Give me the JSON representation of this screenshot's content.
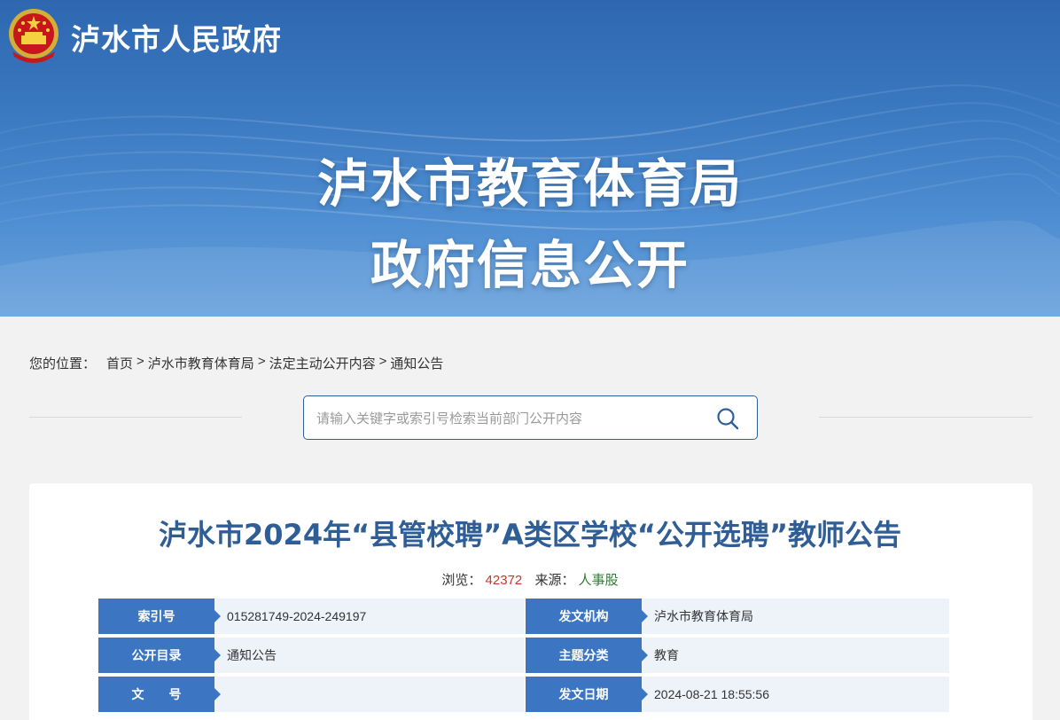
{
  "header": {
    "site_name": "泸水市人民政府",
    "banner_line1": "泸水市教育体育局",
    "banner_line2": "政府信息公开"
  },
  "breadcrumb": {
    "prefix": "您的位置：",
    "items": [
      "首页",
      "泸水市教育体育局",
      "法定主动公开内容",
      "通知公告"
    ],
    "separator": ">"
  },
  "search": {
    "placeholder": "请输入关键字或索引号检索当前部门公开内容",
    "icon": "search-icon"
  },
  "article": {
    "title": "泸水市2024年“县管校聘”A类区学校“公开选聘”教师公告",
    "views_label": "浏览：",
    "views": "42372",
    "source_label": "来源：",
    "source": "人事股"
  },
  "info": [
    {
      "label": "索引号",
      "value": "015281749-2024-249197",
      "label2": "发文机构",
      "value2": "泸水市教育体育局"
    },
    {
      "label": "公开目录",
      "value": "通知公告",
      "label2": "主题分类",
      "value2": "教育"
    },
    {
      "label": "文　　号",
      "value": "",
      "label2": "发文日期",
      "value2": "2024-08-21 18:55:56"
    }
  ],
  "colors": {
    "banner": "#3a78c0",
    "title": "#2f5d96",
    "label_bg": "#3c76c3",
    "value_bg": "#eef2f9",
    "views": "#c0392b",
    "source": "#2e7d32"
  }
}
